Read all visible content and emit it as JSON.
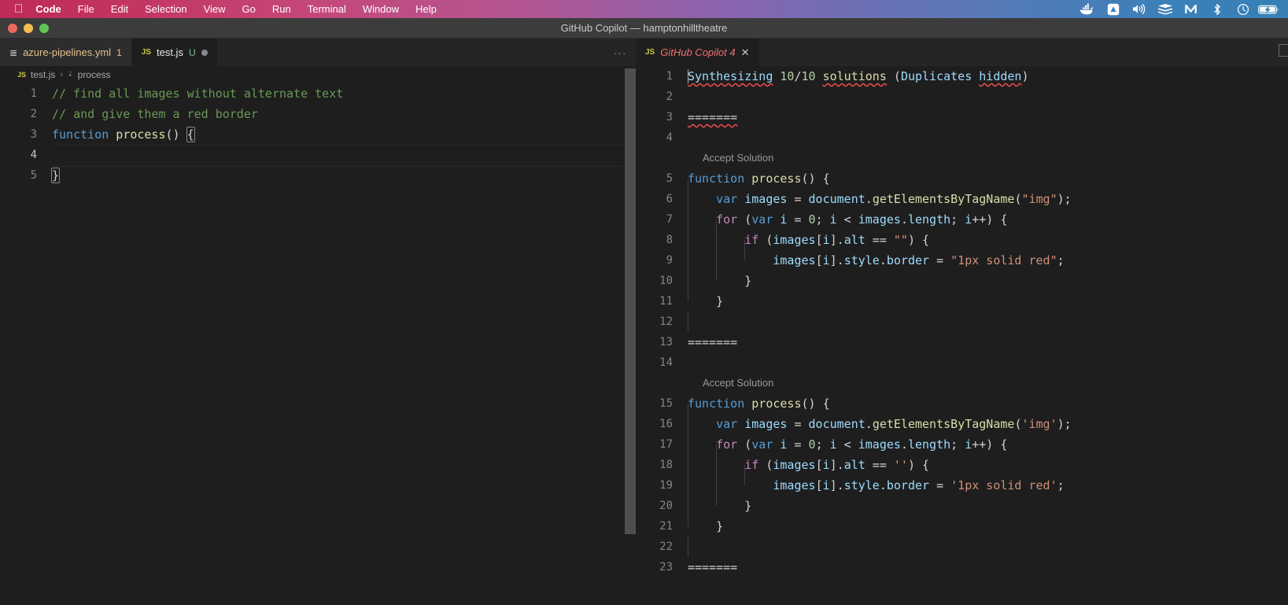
{
  "menubar": {
    "apple_icon": "apple-logo",
    "items": [
      {
        "label": "Code",
        "bold": true
      },
      {
        "label": "File",
        "bold": false
      },
      {
        "label": "Edit",
        "bold": false
      },
      {
        "label": "Selection",
        "bold": false
      },
      {
        "label": "View",
        "bold": false
      },
      {
        "label": "Go",
        "bold": false
      },
      {
        "label": "Run",
        "bold": false
      },
      {
        "label": "Terminal",
        "bold": false
      },
      {
        "label": "Window",
        "bold": false
      },
      {
        "label": "Help",
        "bold": false
      }
    ],
    "tray_icons": [
      "docker-whale-icon",
      "dropbox-triangle-icon",
      "volume-icon",
      "layers-stack-icon",
      "malwarebytes-icon",
      "bluetooth-icon",
      "clock-icon",
      "battery-charging-icon"
    ]
  },
  "window": {
    "title": "GitHub Copilot — hamptonhilltheatre",
    "traffic_lights": [
      "close-red",
      "minimize-yellow",
      "zoom-green"
    ]
  },
  "editor": {
    "tabs": [
      {
        "label": "azure-pipelines.yml",
        "icon": "yaml-icon",
        "badge": "1",
        "active": false
      },
      {
        "label": "test.js",
        "icon": "js-icon",
        "modifier": "U",
        "dirty": true,
        "active": true
      }
    ],
    "more_actions": "···",
    "breadcrumb": {
      "file": "test.js",
      "separator": "›",
      "symbol": "process",
      "file_icon": "js-icon",
      "symbol_icon": "symbol-method-icon"
    },
    "lines": [
      {
        "n": "1",
        "tokens": [
          {
            "t": "// find all images without alternate text",
            "c": "c-com"
          }
        ]
      },
      {
        "n": "2",
        "tokens": [
          {
            "t": "// and give them a red border",
            "c": "c-com"
          }
        ]
      },
      {
        "n": "3",
        "tokens": [
          {
            "t": "function ",
            "c": "c-kw"
          },
          {
            "t": "process",
            "c": "c-fn"
          },
          {
            "t": "() ",
            "c": "c-plain"
          },
          {
            "t": "{",
            "c": "c-plain",
            "box": true
          }
        ]
      },
      {
        "n": "4",
        "tokens": [],
        "current": true
      },
      {
        "n": "5",
        "tokens": [
          {
            "t": "}",
            "c": "c-plain",
            "box": true
          }
        ]
      }
    ]
  },
  "copilot": {
    "tab": {
      "label": "GitHub Copilot 4",
      "icon": "js-icon",
      "close_icon": "close-icon"
    },
    "accept_label": "Accept Solution",
    "lines": [
      {
        "n": "1",
        "tokens": [
          {
            "t": "Synthesizing",
            "c": "c-var",
            "squiggle": true,
            "caret": true
          },
          {
            "t": " ",
            "c": "c-plain"
          },
          {
            "t": "10",
            "c": "c-num"
          },
          {
            "t": "/",
            "c": "c-plain"
          },
          {
            "t": "10",
            "c": "c-num"
          },
          {
            "t": " ",
            "c": "c-plain"
          },
          {
            "t": "solutions",
            "c": "c-fn",
            "squiggle": true
          },
          {
            "t": " (",
            "c": "c-plain"
          },
          {
            "t": "Duplicates",
            "c": "c-var"
          },
          {
            "t": " ",
            "c": "c-plain"
          },
          {
            "t": "hidden",
            "c": "c-var",
            "squiggle": true
          },
          {
            "t": ")",
            "c": "c-plain"
          }
        ]
      },
      {
        "n": "2",
        "tokens": []
      },
      {
        "n": "3",
        "tokens": [
          {
            "t": "=======",
            "c": "c-sep",
            "squiggle": true
          }
        ]
      },
      {
        "n": "4",
        "tokens": []
      },
      {
        "lens": "Accept Solution"
      },
      {
        "n": "5",
        "tokens": [
          {
            "t": "function ",
            "c": "c-kw"
          },
          {
            "t": "process",
            "c": "c-fn"
          },
          {
            "t": "() {",
            "c": "c-plain"
          }
        ]
      },
      {
        "n": "6",
        "indent": 1,
        "tokens": [
          {
            "t": "    ",
            "c": "c-plain"
          },
          {
            "t": "var ",
            "c": "c-kw"
          },
          {
            "t": "images",
            "c": "c-var"
          },
          {
            "t": " = ",
            "c": "c-plain"
          },
          {
            "t": "document",
            "c": "c-var"
          },
          {
            "t": ".",
            "c": "c-plain"
          },
          {
            "t": "getElementsByTagName",
            "c": "c-fn"
          },
          {
            "t": "(",
            "c": "c-plain"
          },
          {
            "t": "\"img\"",
            "c": "c-str"
          },
          {
            "t": ");",
            "c": "c-plain"
          }
        ]
      },
      {
        "n": "7",
        "indent": 1,
        "tokens": [
          {
            "t": "    ",
            "c": "c-plain"
          },
          {
            "t": "for ",
            "c": "c-ctl"
          },
          {
            "t": "(",
            "c": "c-plain"
          },
          {
            "t": "var ",
            "c": "c-kw"
          },
          {
            "t": "i",
            "c": "c-var"
          },
          {
            "t": " = ",
            "c": "c-plain"
          },
          {
            "t": "0",
            "c": "c-num"
          },
          {
            "t": "; ",
            "c": "c-plain"
          },
          {
            "t": "i",
            "c": "c-var"
          },
          {
            "t": " < ",
            "c": "c-plain"
          },
          {
            "t": "images",
            "c": "c-var"
          },
          {
            "t": ".",
            "c": "c-plain"
          },
          {
            "t": "length",
            "c": "c-var"
          },
          {
            "t": "; ",
            "c": "c-plain"
          },
          {
            "t": "i",
            "c": "c-var"
          },
          {
            "t": "++) {",
            "c": "c-plain"
          }
        ]
      },
      {
        "n": "8",
        "indent": 2,
        "tokens": [
          {
            "t": "        ",
            "c": "c-plain"
          },
          {
            "t": "if ",
            "c": "c-ctl"
          },
          {
            "t": "(",
            "c": "c-plain"
          },
          {
            "t": "images",
            "c": "c-var"
          },
          {
            "t": "[",
            "c": "c-plain"
          },
          {
            "t": "i",
            "c": "c-var"
          },
          {
            "t": "].",
            "c": "c-plain"
          },
          {
            "t": "alt",
            "c": "c-var"
          },
          {
            "t": " == ",
            "c": "c-plain"
          },
          {
            "t": "\"\"",
            "c": "c-str"
          },
          {
            "t": ") {",
            "c": "c-plain"
          }
        ]
      },
      {
        "n": "9",
        "indent": 3,
        "tokens": [
          {
            "t": "            ",
            "c": "c-plain"
          },
          {
            "t": "images",
            "c": "c-var"
          },
          {
            "t": "[",
            "c": "c-plain"
          },
          {
            "t": "i",
            "c": "c-var"
          },
          {
            "t": "].",
            "c": "c-plain"
          },
          {
            "t": "style",
            "c": "c-var"
          },
          {
            "t": ".",
            "c": "c-plain"
          },
          {
            "t": "border",
            "c": "c-var"
          },
          {
            "t": " = ",
            "c": "c-plain"
          },
          {
            "t": "\"1px solid red\"",
            "c": "c-str"
          },
          {
            "t": ";",
            "c": "c-plain"
          }
        ]
      },
      {
        "n": "10",
        "indent": 2,
        "tokens": [
          {
            "t": "        }",
            "c": "c-plain"
          }
        ]
      },
      {
        "n": "11",
        "indent": 1,
        "tokens": [
          {
            "t": "    }",
            "c": "c-plain"
          }
        ]
      },
      {
        "n": "12",
        "indent": 1,
        "tokens": []
      },
      {
        "n": "13",
        "tokens": [
          {
            "t": "=======",
            "c": "c-sep"
          }
        ]
      },
      {
        "n": "14",
        "tokens": []
      },
      {
        "lens": "Accept Solution"
      },
      {
        "n": "15",
        "tokens": [
          {
            "t": "function ",
            "c": "c-kw"
          },
          {
            "t": "process",
            "c": "c-fn"
          },
          {
            "t": "() {",
            "c": "c-plain"
          }
        ]
      },
      {
        "n": "16",
        "indent": 1,
        "tokens": [
          {
            "t": "    ",
            "c": "c-plain"
          },
          {
            "t": "var ",
            "c": "c-kw"
          },
          {
            "t": "images",
            "c": "c-var"
          },
          {
            "t": " = ",
            "c": "c-plain"
          },
          {
            "t": "document",
            "c": "c-var"
          },
          {
            "t": ".",
            "c": "c-plain"
          },
          {
            "t": "getElementsByTagName",
            "c": "c-fn"
          },
          {
            "t": "(",
            "c": "c-plain"
          },
          {
            "t": "'img'",
            "c": "c-str"
          },
          {
            "t": ");",
            "c": "c-plain"
          }
        ]
      },
      {
        "n": "17",
        "indent": 1,
        "tokens": [
          {
            "t": "    ",
            "c": "c-plain"
          },
          {
            "t": "for ",
            "c": "c-ctl"
          },
          {
            "t": "(",
            "c": "c-plain"
          },
          {
            "t": "var ",
            "c": "c-kw"
          },
          {
            "t": "i",
            "c": "c-var"
          },
          {
            "t": " = ",
            "c": "c-plain"
          },
          {
            "t": "0",
            "c": "c-num"
          },
          {
            "t": "; ",
            "c": "c-plain"
          },
          {
            "t": "i",
            "c": "c-var"
          },
          {
            "t": " < ",
            "c": "c-plain"
          },
          {
            "t": "images",
            "c": "c-var"
          },
          {
            "t": ".",
            "c": "c-plain"
          },
          {
            "t": "length",
            "c": "c-var"
          },
          {
            "t": "; ",
            "c": "c-plain"
          },
          {
            "t": "i",
            "c": "c-var"
          },
          {
            "t": "++) {",
            "c": "c-plain"
          }
        ]
      },
      {
        "n": "18",
        "indent": 2,
        "tokens": [
          {
            "t": "        ",
            "c": "c-plain"
          },
          {
            "t": "if ",
            "c": "c-ctl"
          },
          {
            "t": "(",
            "c": "c-plain"
          },
          {
            "t": "images",
            "c": "c-var"
          },
          {
            "t": "[",
            "c": "c-plain"
          },
          {
            "t": "i",
            "c": "c-var"
          },
          {
            "t": "].",
            "c": "c-plain"
          },
          {
            "t": "alt",
            "c": "c-var"
          },
          {
            "t": " == ",
            "c": "c-plain"
          },
          {
            "t": "''",
            "c": "c-str"
          },
          {
            "t": ") {",
            "c": "c-plain"
          }
        ]
      },
      {
        "n": "19",
        "indent": 3,
        "tokens": [
          {
            "t": "            ",
            "c": "c-plain"
          },
          {
            "t": "images",
            "c": "c-var"
          },
          {
            "t": "[",
            "c": "c-plain"
          },
          {
            "t": "i",
            "c": "c-var"
          },
          {
            "t": "].",
            "c": "c-plain"
          },
          {
            "t": "style",
            "c": "c-var"
          },
          {
            "t": ".",
            "c": "c-plain"
          },
          {
            "t": "border",
            "c": "c-var"
          },
          {
            "t": " = ",
            "c": "c-plain"
          },
          {
            "t": "'1px solid red'",
            "c": "c-str"
          },
          {
            "t": ";",
            "c": "c-plain"
          }
        ]
      },
      {
        "n": "20",
        "indent": 2,
        "tokens": [
          {
            "t": "        }",
            "c": "c-plain"
          }
        ]
      },
      {
        "n": "21",
        "indent": 1,
        "tokens": [
          {
            "t": "    }",
            "c": "c-plain"
          }
        ]
      },
      {
        "n": "22",
        "indent": 1,
        "tokens": []
      },
      {
        "n": "23",
        "tokens": [
          {
            "t": "=======",
            "c": "c-sep"
          }
        ]
      }
    ]
  },
  "colors": {
    "editor_bg": "#1e1e1e",
    "tabbar_bg": "#252526",
    "titlebar_bg": "#3c3c3c",
    "comment": "#6a9955",
    "keyword": "#569cd6",
    "control": "#c586c0",
    "function": "#dcdcaa",
    "variable": "#9cdcfe",
    "string": "#ce9178",
    "number": "#b5cea8",
    "error_squiggle": "#f14c4c",
    "copilot_tab_text": "#f07070",
    "yaml_tab_text": "#e2c08d"
  }
}
